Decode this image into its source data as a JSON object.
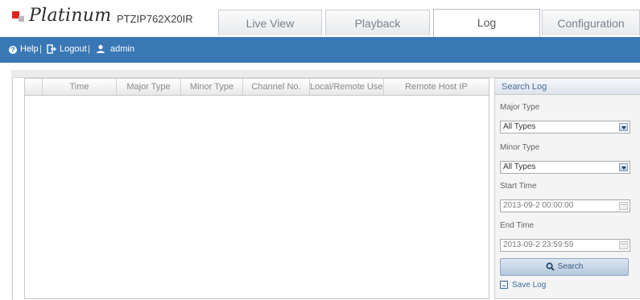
{
  "header": {
    "brand": "Platinum",
    "model": "PTZIP762X20IR",
    "tabs": [
      {
        "label": "Live View",
        "active": false
      },
      {
        "label": "Playback",
        "active": false
      },
      {
        "label": "Log",
        "active": true
      },
      {
        "label": "Configuration",
        "active": false
      }
    ]
  },
  "toolbar": {
    "help_label": "Help",
    "logout_label": "Logout",
    "user_label": "admin",
    "separator": "|",
    "icons": {
      "help": "question-circle-icon",
      "logout": "logout-icon",
      "user": "user-icon"
    },
    "bar_color": "#3a78b5"
  },
  "log_table": {
    "columns": [
      "",
      "Time",
      "Major Type",
      "Minor Type",
      "Channel No.",
      "Local/Remote User",
      "Remote Host IP"
    ],
    "rows": []
  },
  "search_log": {
    "title": "Search Log",
    "major_type_label": "Major Type",
    "major_type_value": "All Types",
    "minor_type_label": "Minor Type",
    "minor_type_value": "All Types",
    "start_time_label": "Start Time",
    "start_time_value": "2013-09-2 00:00:00",
    "end_time_label": "End Time",
    "end_time_value": "2013-09-2 23:59:59",
    "search_label": "Search",
    "save_log_label": "Save Log",
    "icons": {
      "search": "search-icon",
      "save": "save-icon",
      "calendar": "calendar-icon",
      "dropdown": "dropdown-arrow-icon"
    }
  }
}
